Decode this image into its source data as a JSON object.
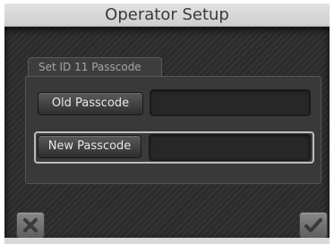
{
  "window": {
    "title": "Operator Setup"
  },
  "form": {
    "tab_label": "Set ID 11 Passcode",
    "old_passcode": {
      "label": "Old Passcode",
      "value": ""
    },
    "new_passcode": {
      "label": "New Passcode",
      "value": ""
    }
  },
  "actions": {
    "cancel_icon": "x-icon",
    "confirm_icon": "checkmark-icon"
  },
  "colors": {
    "background": "#2b2b2b",
    "title_bar": "#d6d6d6",
    "button": "#4a4a4a",
    "text": "#e6e6e6"
  }
}
